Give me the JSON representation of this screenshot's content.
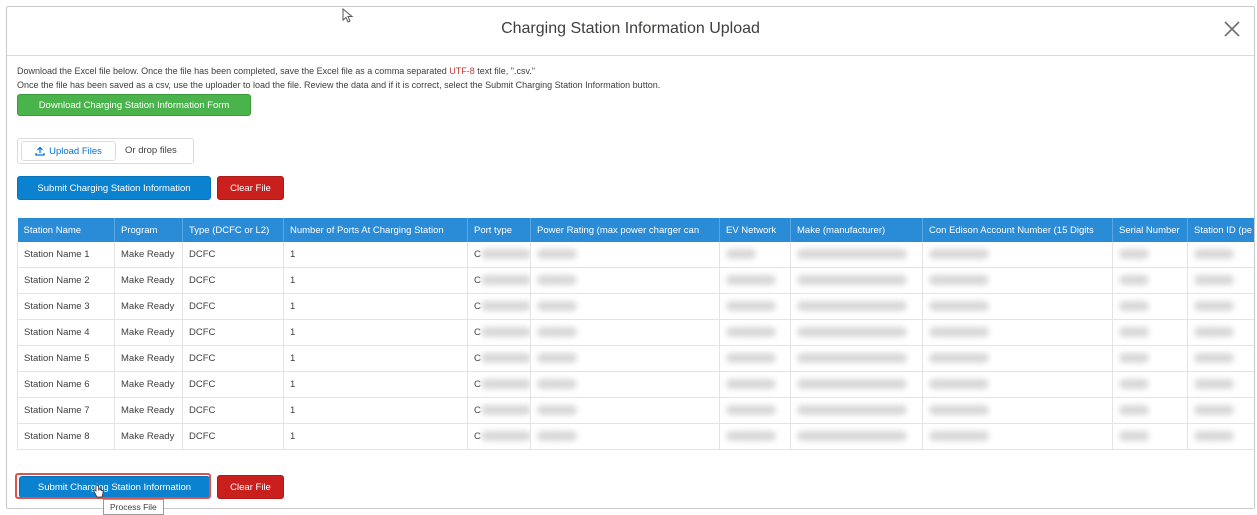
{
  "modal": {
    "title": "Charging Station Information Upload",
    "close_label": "×"
  },
  "instructions": {
    "line1_pre": "Download the Excel file below. Once the file has been completed, save the Excel file as a comma separated ",
    "line1_red": "UTF-8",
    "line1_post": " text file, \".csv.\"",
    "line2": "Once the file has been saved as a csv, use the uploader to load the file. Review the data and if it is correct, select the Submit Charging Station Information button."
  },
  "buttons": {
    "download_form": "Download Charging Station Information Form",
    "upload_files": "Upload Files",
    "or_drop": "Or drop files",
    "submit": "Submit Charging Station Information",
    "clear": "Clear File"
  },
  "table": {
    "headers": [
      "Station Name",
      "Program",
      "Type (DCFC or L2)",
      "Number of Ports At Charging Station",
      "Port type",
      "Power Rating (max power charger can",
      "EV Network",
      "Make (manufacturer)",
      "Con Edison Account Number (15 Digits",
      "Serial Number",
      "Station ID (pe"
    ],
    "rows": [
      {
        "name": "Station Name 1",
        "program": "Make Ready",
        "type": "DCFC",
        "ports": "1",
        "port_type": "C"
      },
      {
        "name": "Station Name 2",
        "program": "Make Ready",
        "type": "DCFC",
        "ports": "1",
        "port_type": "C"
      },
      {
        "name": "Station Name 3",
        "program": "Make Ready",
        "type": "DCFC",
        "ports": "1",
        "port_type": "C"
      },
      {
        "name": "Station Name 4",
        "program": "Make Ready",
        "type": "DCFC",
        "ports": "1",
        "port_type": "C"
      },
      {
        "name": "Station Name 5",
        "program": "Make Ready",
        "type": "DCFC",
        "ports": "1",
        "port_type": "C"
      },
      {
        "name": "Station Name 6",
        "program": "Make Ready",
        "type": "DCFC",
        "ports": "1",
        "port_type": "C"
      },
      {
        "name": "Station Name 7",
        "program": "Make Ready",
        "type": "DCFC",
        "ports": "1",
        "port_type": "C"
      },
      {
        "name": "Station Name 8",
        "program": "Make Ready",
        "type": "DCFC",
        "ports": "1",
        "port_type": "C"
      }
    ]
  },
  "tooltip": "Process File",
  "icons": {
    "close": "close-icon",
    "upload": "upload-icon",
    "pointer": "mouse-pointer-icon",
    "hand": "hand-cursor-icon"
  },
  "colors": {
    "green_button": "#4bb34b",
    "blue_button": "#0b82d0",
    "red_button": "#c9201e",
    "table_header": "#2a8bd6",
    "highlight": "#d9534f",
    "link_blue": "#0070d2"
  }
}
